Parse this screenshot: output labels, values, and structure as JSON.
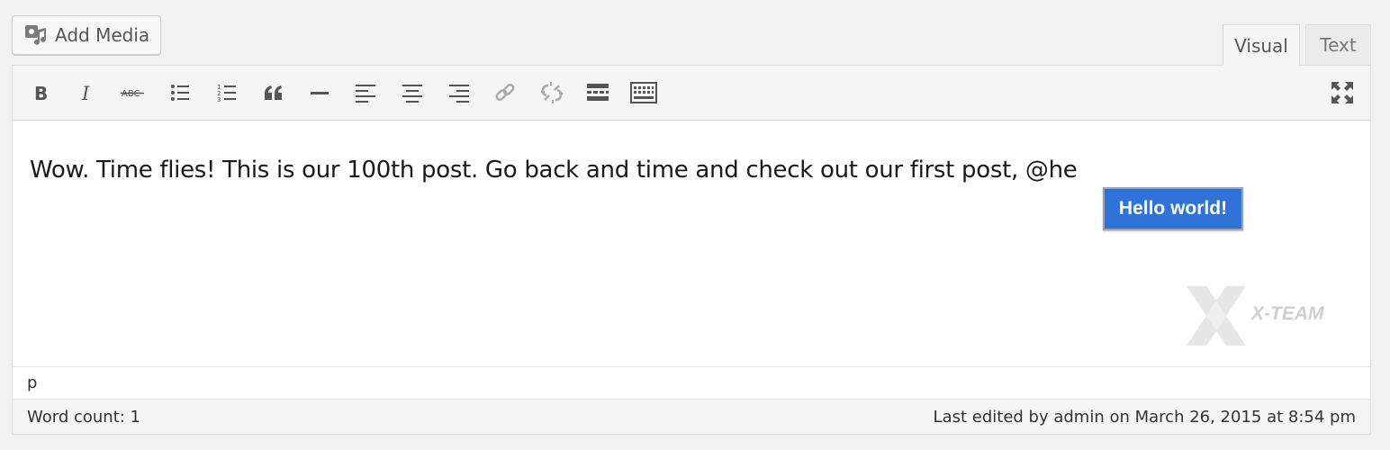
{
  "add_media": {
    "label": "Add Media",
    "icon": "media-icon"
  },
  "tabs": [
    {
      "label": "Visual",
      "active": true
    },
    {
      "label": "Text",
      "active": false
    }
  ],
  "toolbar": {
    "buttons": [
      "bold-icon",
      "italic-icon",
      "strikethrough-icon",
      "bullet-list-icon",
      "numbered-list-icon",
      "blockquote-icon",
      "horizontal-rule-icon",
      "align-left-icon",
      "align-center-icon",
      "align-right-icon",
      "link-icon",
      "unlink-icon",
      "read-more-icon",
      "toolbar-toggle-icon"
    ],
    "fullscreen_icon": "fullscreen-icon"
  },
  "content": {
    "paragraph": "Wow. Time flies! This is our 100th post. Go back and time and check out our first post, @he"
  },
  "suggestion": {
    "label": "Hello world!"
  },
  "watermark": {
    "text": "X-TEAM"
  },
  "path": {
    "element": "p"
  },
  "status": {
    "word_count": "Word count: 1",
    "last_edited": "Last edited by admin on March 26, 2015 at 8:54 pm"
  },
  "colors": {
    "accent": "#2f73d8",
    "background": "#f1f1f1",
    "toolbar": "#f5f5f5"
  }
}
